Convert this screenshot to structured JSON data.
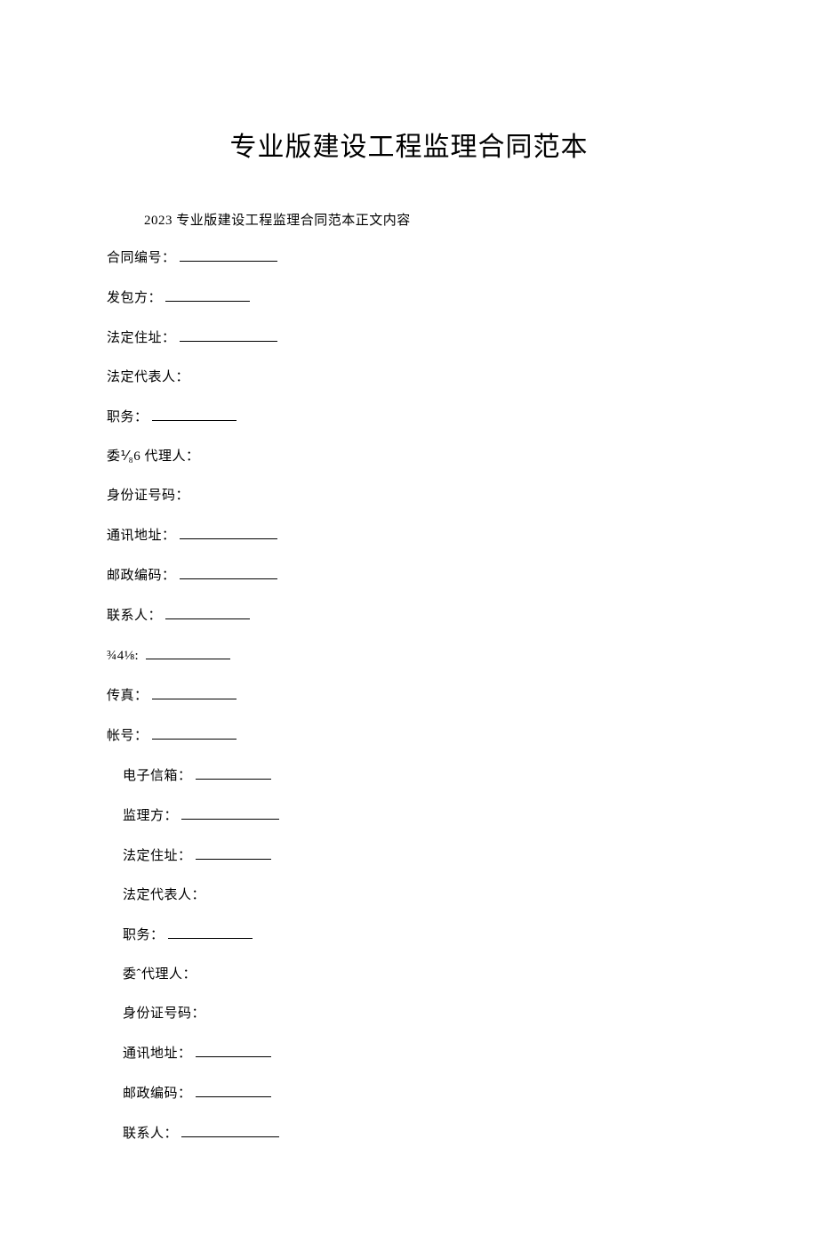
{
  "title": "专业版建设工程监理合同范本",
  "subtitle": "2023 专业版建设工程监理合同范本正文内容",
  "fields": {
    "contract_no_label": "合同编号：",
    "party_a_label": "发包方：",
    "legal_address_label": "法定住址：",
    "legal_rep_label": "法定代表人：",
    "position_label": "职务：",
    "agent_label_a": "委⅟₈6 代理人：",
    "id_number_label": "身份证号码：",
    "mailing_address_label": "通讯地址：",
    "postal_code_label": "邮政编码：",
    "contact_label": "联系人：",
    "phone_label": "¾4⅛:",
    "fax_label": "传真：",
    "account_label": "帐号：",
    "email_label": "电子信箱：",
    "party_b_label": "监理方：",
    "legal_address_b_label": "法定住址：",
    "legal_rep_b_label": "法定代表人：",
    "position_b_label": "职务：",
    "agent_label_b": "委ˆ代理人：",
    "id_number_b_label": "身份证号码：",
    "mailing_address_b_label": "通讯地址：",
    "postal_code_b_label": "邮政编码：",
    "contact_b_label": "联系人："
  }
}
